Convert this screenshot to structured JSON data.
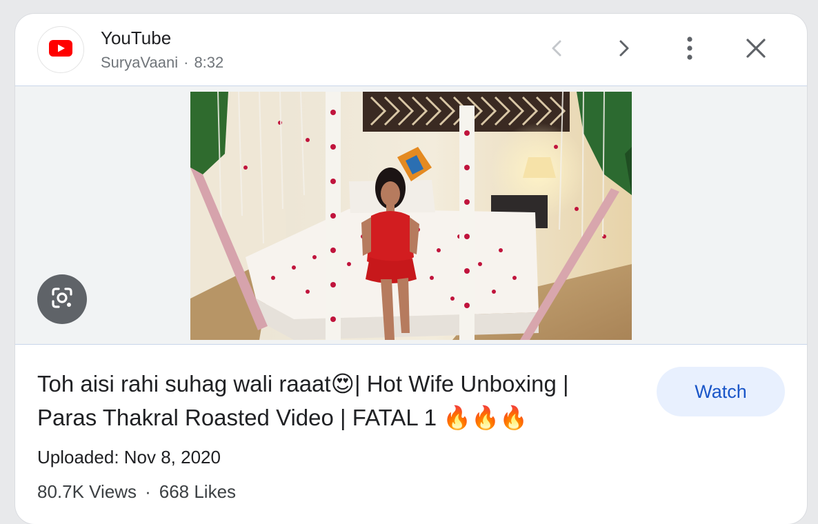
{
  "source": {
    "name": "YouTube",
    "channel": "SuryaVaani",
    "separator": "·",
    "duration": "8:32",
    "logo_icon": "youtube-logo-icon",
    "brand_color": "#ff0000"
  },
  "header_actions": {
    "previous_icon": "chevron-left-icon",
    "next_icon": "chevron-right-icon",
    "more_icon": "more-vert-icon",
    "close_icon": "close-icon"
  },
  "media": {
    "lens_icon": "google-lens-icon"
  },
  "video": {
    "title": "Toh aisi rahi suhag wali raaat😍| Hot Wife Unboxing | Paras Thakral Roasted Video | FATAL 1 🔥🔥🔥",
    "watch_label": "Watch",
    "uploaded": "Uploaded: Nov 8, 2020",
    "views": "80.7K Views",
    "stats_separator": "·",
    "likes": "668 Likes"
  },
  "colors": {
    "accent": "#1a56c8",
    "watch_bg": "#e8f0fe",
    "meta_text": "#70757a"
  }
}
